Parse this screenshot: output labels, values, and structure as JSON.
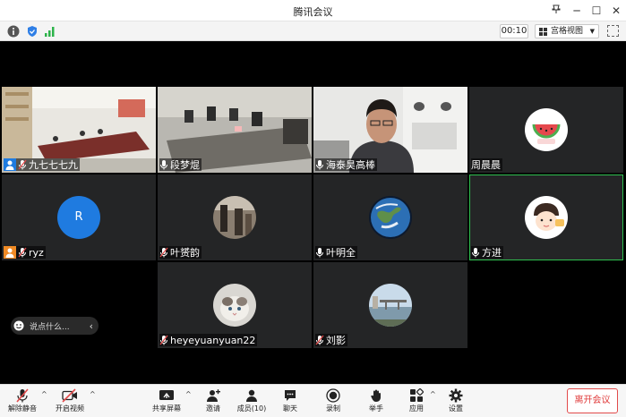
{
  "window": {
    "title": "腾讯会议"
  },
  "toolbar": {
    "timer": "00:10",
    "view_label": "宫格视图"
  },
  "chat": {
    "placeholder": "说点什么..."
  },
  "participants": [
    {
      "name": "九七七七九"
    },
    {
      "name": "段梦焜"
    },
    {
      "name": "海泰昊高棒"
    },
    {
      "name": "周晨晨"
    },
    {
      "name": "ryz",
      "initial": "R"
    },
    {
      "name": "叶赟韵"
    },
    {
      "name": "叶明全"
    },
    {
      "name": "方进"
    },
    {
      "name": "heyeyuanyuan22"
    },
    {
      "name": "刘影"
    }
  ],
  "bottom": {
    "unmute": "解除静音",
    "start_video": "开启视频",
    "share": "共享屏幕",
    "invite": "邀请",
    "members": "成员(10)",
    "chat": "聊天",
    "record": "录制",
    "raise_hand": "举手",
    "apps": "应用",
    "settings": "设置",
    "leave": "离开会议"
  },
  "colors": {
    "active_border": "#2fbf4f",
    "leave": "#e03a3a",
    "avatar_blue": "#1f7be0",
    "host_orange": "#f08a24"
  }
}
